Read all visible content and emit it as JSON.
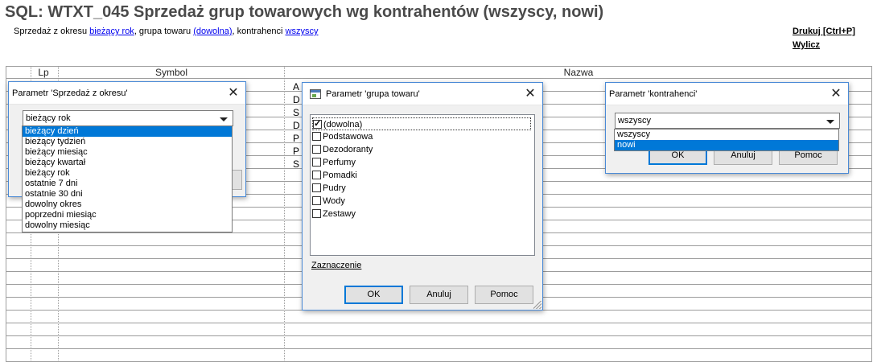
{
  "title": "SQL: WTXT_045 Sprzedaż grup towarowych wg kontrahentów (wszyscy, nowi)",
  "subline": {
    "prefix": "Sprzedaż z okresu",
    "period_link": "bieżący rok",
    "group_prefix": ", grupa towaru",
    "group_link": "(dowolna)",
    "contractors_prefix": ", kontrahenci",
    "contractors_link": "wszyscy"
  },
  "commands": {
    "print": "Drukuj [Ctrl+P]",
    "calc": "Wylicz"
  },
  "grid": {
    "headers": [
      "Lp",
      "Symbol",
      "Nazwa"
    ],
    "visible_letters": [
      "A",
      "D",
      "S",
      "D",
      "P",
      "P",
      "S"
    ]
  },
  "dialog_period": {
    "title": "Parametr 'Sprzedaż z okresu'",
    "selected": "bieżący rok",
    "options": [
      "bieżący dzień",
      "bieżący tydzień",
      "bieżący miesiąc",
      "bieżący kwartał",
      "bieżący rok",
      "ostatnie 7 dni",
      "ostatnie 30 dni",
      "dowolny okres",
      "poprzedni miesiąc",
      "dowolny miesiąc"
    ],
    "highlighted_index": 0
  },
  "dialog_group": {
    "title": "Parametr 'grupa towaru'",
    "items": [
      {
        "label": "(dowolna)",
        "checked": true
      },
      {
        "label": "Podstawowa",
        "checked": false
      },
      {
        "label": "Dezodoranty",
        "checked": false
      },
      {
        "label": "Perfumy",
        "checked": false
      },
      {
        "label": "Pomadki",
        "checked": false
      },
      {
        "label": "Pudry",
        "checked": false
      },
      {
        "label": "Wody",
        "checked": false
      },
      {
        "label": "Zestawy",
        "checked": false
      }
    ],
    "selection_link": "Zaznaczenie",
    "ok": "OK",
    "cancel": "Anuluj",
    "help": "Pomoc"
  },
  "dialog_contractors": {
    "title": "Parametr 'kontrahenci'",
    "selected": "wszyscy",
    "options": [
      "wszyscy",
      "nowi"
    ],
    "highlighted_index": 1,
    "ok": "OK",
    "cancel": "Anuluj",
    "help": "Pomoc"
  },
  "colors": {
    "title": "#4a4a4a",
    "link": "#0000ee",
    "selection": "#0078d7",
    "dialog_border": "#4a8ad6"
  }
}
